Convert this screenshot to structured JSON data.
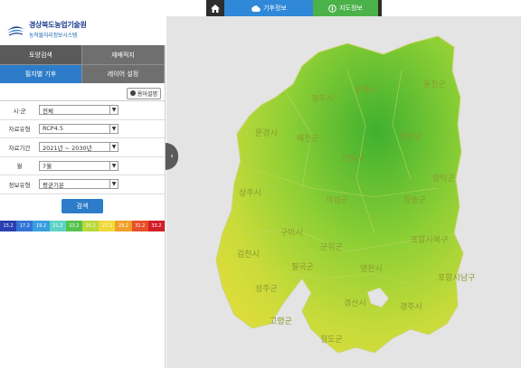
{
  "topnav": {
    "home_icon": "home-icon",
    "weather_label": "기후정보",
    "weather_icon": "cloud-icon",
    "soil_label": "지도정보",
    "soil_icon": "compass-icon",
    "colors": {
      "weather": "#2f89d8",
      "soil": "#4bb24a",
      "dark": "#2d2d2d"
    }
  },
  "logo": {
    "title": "경상북도농업기술원",
    "subtitle": "농작물자리정보시스템"
  },
  "menu": {
    "row1": [
      "토양검색",
      "재배적지"
    ],
    "row2": [
      "필지별 기후",
      "레이어 설정"
    ],
    "active": "필지별 기후"
  },
  "help": {
    "label": "용어설명"
  },
  "form": {
    "fields": [
      {
        "label": "시·군",
        "value": "전체"
      },
      {
        "label": "자료유형",
        "value": "RCP4.5"
      },
      {
        "label": "자료기간",
        "value": "2021년 ~ 2030년"
      },
      {
        "label": "월",
        "value": "7월"
      },
      {
        "label": "정보유형",
        "value": "평균기온"
      }
    ],
    "search_label": "검색"
  },
  "legend": [
    {
      "label": "15.2",
      "color": "#2a3fb0"
    },
    {
      "label": "17.2",
      "color": "#3474d6"
    },
    {
      "label": "19.2",
      "color": "#3a9ee0"
    },
    {
      "label": "21.2",
      "color": "#5fd3c4"
    },
    {
      "label": "23.2",
      "color": "#56c24c"
    },
    {
      "label": "25.2",
      "color": "#b8d93a"
    },
    {
      "label": "27.2",
      "color": "#f2d93a"
    },
    {
      "label": "29.2",
      "color": "#f0a02a"
    },
    {
      "label": "31.2",
      "color": "#e8502a"
    },
    {
      "label": "33.2",
      "color": "#d41f2a"
    }
  ],
  "map": {
    "toggle_icon": "chevron-left-icon",
    "regions": [
      "봉화군",
      "울진군",
      "영주시",
      "문경시",
      "예천군",
      "안동시",
      "영양군",
      "영덕군",
      "상주시",
      "의성군",
      "청송군",
      "구미시",
      "군위군",
      "김천시",
      "칠곡군",
      "영천시",
      "포항시북구",
      "포항시남구",
      "성주군",
      "고령군",
      "경산시",
      "경주시",
      "청도군"
    ]
  }
}
